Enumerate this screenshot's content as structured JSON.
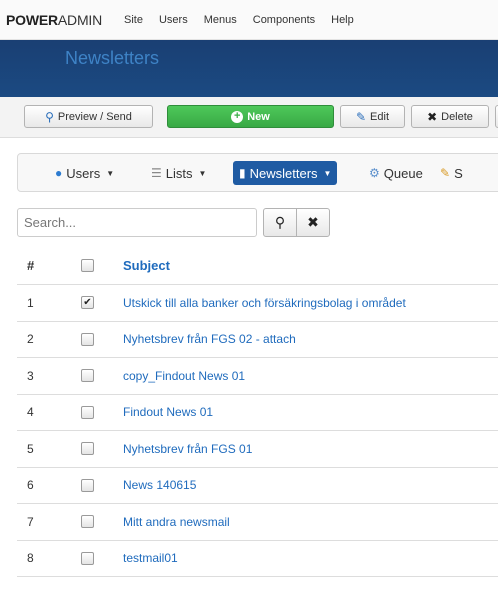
{
  "topbar": {
    "brand_bold": "POWER",
    "brand_light": "ADMIN",
    "menu": [
      "Site",
      "Users",
      "Menus",
      "Components",
      "Help"
    ]
  },
  "header": {
    "title": "Newsletters"
  },
  "toolbar": {
    "preview_label": "Preview / Send",
    "new_label": "New",
    "edit_label": "Edit",
    "delete_label": "Delete"
  },
  "subnav": {
    "users": "Users",
    "lists": "Lists",
    "newsletters": "Newsletters",
    "queue": "Queue",
    "s": "S"
  },
  "search": {
    "placeholder": "Search...",
    "value": ""
  },
  "table": {
    "headers": {
      "num": "#",
      "subject": "Subject"
    },
    "rows": [
      {
        "num": "1",
        "checked": true,
        "subject": "Utskick till alla banker och försäkringsbolag i området"
      },
      {
        "num": "2",
        "checked": false,
        "subject": "Nyhetsbrev från FGS 02 - attach"
      },
      {
        "num": "3",
        "checked": false,
        "subject": "copy_Findout News 01"
      },
      {
        "num": "4",
        "checked": false,
        "subject": "Findout News 01"
      },
      {
        "num": "5",
        "checked": false,
        "subject": "Nyhetsbrev från FGS 01"
      },
      {
        "num": "6",
        "checked": false,
        "subject": "News 140615"
      },
      {
        "num": "7",
        "checked": false,
        "subject": "Mitt andra newsmail"
      },
      {
        "num": "8",
        "checked": false,
        "subject": "testmail01"
      }
    ]
  },
  "colors": {
    "header_bg": "#1b4a82",
    "header_title": "#3e83c6",
    "new_button": "#3fb34f",
    "link": "#1f6bbd",
    "active_tab": "#1f5ba3"
  }
}
